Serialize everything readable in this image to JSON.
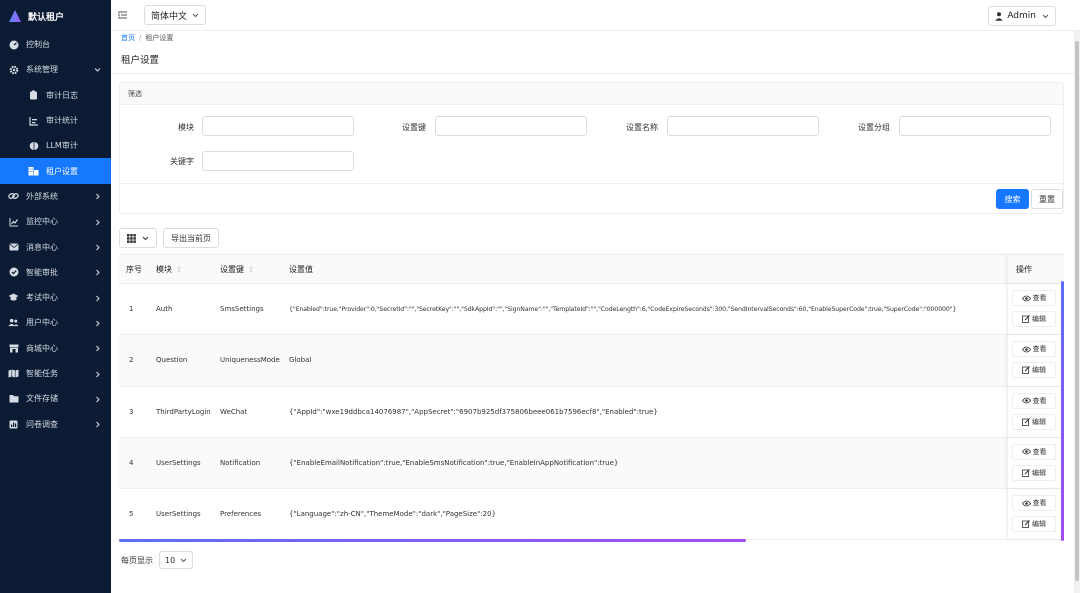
{
  "app": {
    "name": "默认租户"
  },
  "sidebar": {
    "items": [
      {
        "label": "控制台",
        "icon": "dashboard-icon"
      },
      {
        "label": "系统管理",
        "icon": "gear-icon",
        "expanded": true
      },
      {
        "label": "外部系统",
        "icon": "link-icon"
      },
      {
        "label": "监控中心",
        "icon": "line-chart-icon"
      },
      {
        "label": "消息中心",
        "icon": "mail-icon"
      },
      {
        "label": "智能审批",
        "icon": "check-circle-icon"
      },
      {
        "label": "考试中心",
        "icon": "graduation-cap-icon"
      },
      {
        "label": "用户中心",
        "icon": "users-icon"
      },
      {
        "label": "商城中心",
        "icon": "store-icon"
      },
      {
        "label": "智能任务",
        "icon": "map-icon"
      },
      {
        "label": "文件存储",
        "icon": "folder-icon"
      },
      {
        "label": "问卷调查",
        "icon": "poll-icon"
      }
    ],
    "sub_items": [
      {
        "label": "审计日志",
        "icon": "clipboard-icon"
      },
      {
        "label": "审计统计",
        "icon": "bar-chart-icon"
      },
      {
        "label": "LLM审计",
        "icon": "brain-icon"
      },
      {
        "label": "租户设置",
        "icon": "building-icon",
        "active": true
      }
    ]
  },
  "header": {
    "language": "简体中文",
    "user": "Admin"
  },
  "breadcrumb": {
    "home": "首页",
    "current": "租户设置"
  },
  "page": {
    "title": "租户设置"
  },
  "filter": {
    "title": "筛选",
    "fields": [
      "模块",
      "设置键",
      "设置名称",
      "设置分组",
      "关键字"
    ],
    "search_label": "搜索",
    "reset_label": "重置"
  },
  "toolbar": {
    "export_label": "导出当前页"
  },
  "table": {
    "columns": [
      "序号",
      "模块",
      "设置键",
      "设置值",
      "操作"
    ],
    "rows": [
      {
        "index": "1",
        "module": "Auth",
        "key": "SmsSettings",
        "value": "{\"Enabled\":true,\"Provider\":0,\"SecretId\":\"\",\"SecretKey\":\"\",\"SdkAppId\":\"\",\"SignName\":\"\",\"TemplateId\":\"\",\"CodeLength\":6,\"CodeExpireSeconds\":300,\"SendIntervalSeconds\":60,\"EnableSuperCode\":true,\"SuperCode\":\"000000\"}"
      },
      {
        "index": "2",
        "module": "Question",
        "key": "UniquenessMode",
        "value": "Global"
      },
      {
        "index": "3",
        "module": "ThirdPartyLogin",
        "key": "WeChat",
        "value": "{\"AppId\":\"wxe19ddbca14076987\",\"AppSecret\":\"6907b925df375806beee061b7596ecf8\",\"Enabled\":true}"
      },
      {
        "index": "4",
        "module": "UserSettings",
        "key": "Notification",
        "value": "{\"EnableEmailNotification\":true,\"EnableSmsNotification\":true,\"EnableInAppNotification\":true}"
      },
      {
        "index": "5",
        "module": "UserSettings",
        "key": "Preferences",
        "value": "{\"Language\":\"zh-CN\",\"ThemeMode\":\"dark\",\"PageSize\":20}"
      }
    ],
    "view_label": "查看",
    "edit_label": "编辑"
  },
  "pagination": {
    "label": "每页显示",
    "size": "10"
  },
  "colors": {
    "sidebar_bg": "#0b1b33",
    "accent": "#1677ff"
  }
}
